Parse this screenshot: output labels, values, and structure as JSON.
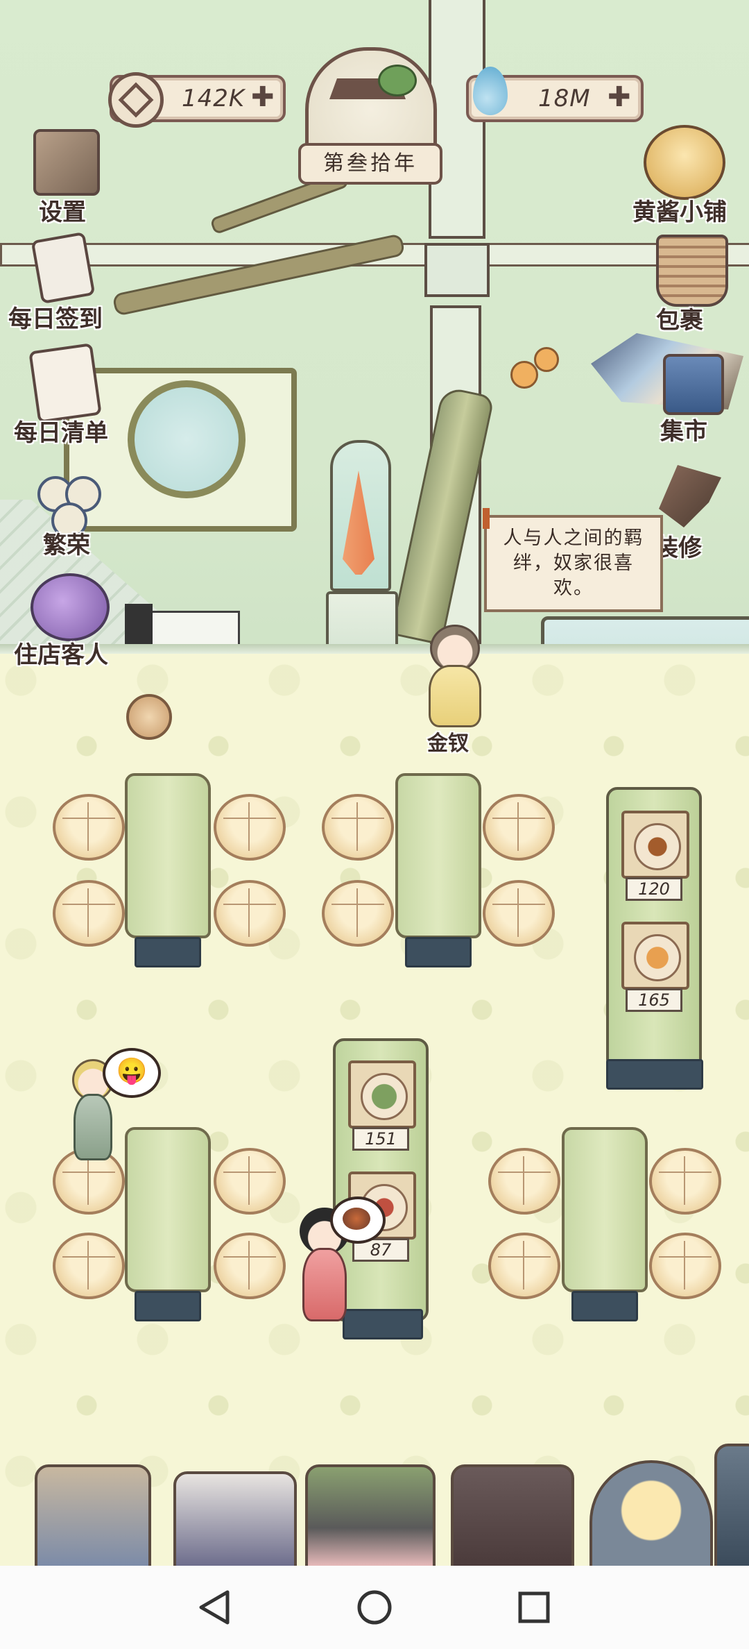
{
  "hud": {
    "coins": {
      "value": "142K",
      "icon": "coin-icon"
    },
    "year": {
      "label": "第叁拾年",
      "icon": "pavilion-icon"
    },
    "water": {
      "value": "18M",
      "icon": "water-drop-icon"
    }
  },
  "left_menu": [
    {
      "label": "设置",
      "icon": "settings-box-icon"
    },
    {
      "label": "每日签到",
      "icon": "brush-paper-icon"
    },
    {
      "label": "每日清单",
      "icon": "checklist-icon"
    },
    {
      "label": "繁荣",
      "icon": "prosperity-coins-icon"
    },
    {
      "label": "住店客人",
      "icon": "guest-bag-icon"
    }
  ],
  "right_menu": [
    {
      "label": "黄酱小铺",
      "icon": "shop-keeper-icon"
    },
    {
      "label": "包裹",
      "icon": "basket-icon"
    },
    {
      "label": "集市",
      "icon": "market-stall-icon"
    },
    {
      "label": "装修",
      "icon": "hammer-icon"
    }
  ],
  "npc": {
    "name": "金钗",
    "speech": "人与人之间的羁绊，奴家很喜欢。"
  },
  "food_tables": [
    {
      "dishes": [
        {
          "price": "120"
        },
        {
          "price": "165"
        }
      ]
    },
    {
      "dishes": [
        {
          "price": "151"
        },
        {
          "price": "87"
        }
      ]
    }
  ],
  "guest_emote": "tongue-out-face-icon",
  "waiter_emote": "noodle-bowl-icon",
  "bottom_strip": [
    {
      "name": "steamer-chef"
    },
    {
      "name": "crane-cook"
    },
    {
      "name": "pig-farmer"
    },
    {
      "name": "bed-room"
    },
    {
      "name": "blonde-girl"
    },
    {
      "name": "armored-guard"
    }
  ],
  "navbar": {
    "back": "back-triangle-icon",
    "home": "home-circle-icon",
    "recents": "recents-square-icon"
  },
  "colors": {
    "wall": "#d9ebcf",
    "floor": "#f6f6d6",
    "border": "#5c4e44",
    "table_green": "#cfe0ab"
  }
}
